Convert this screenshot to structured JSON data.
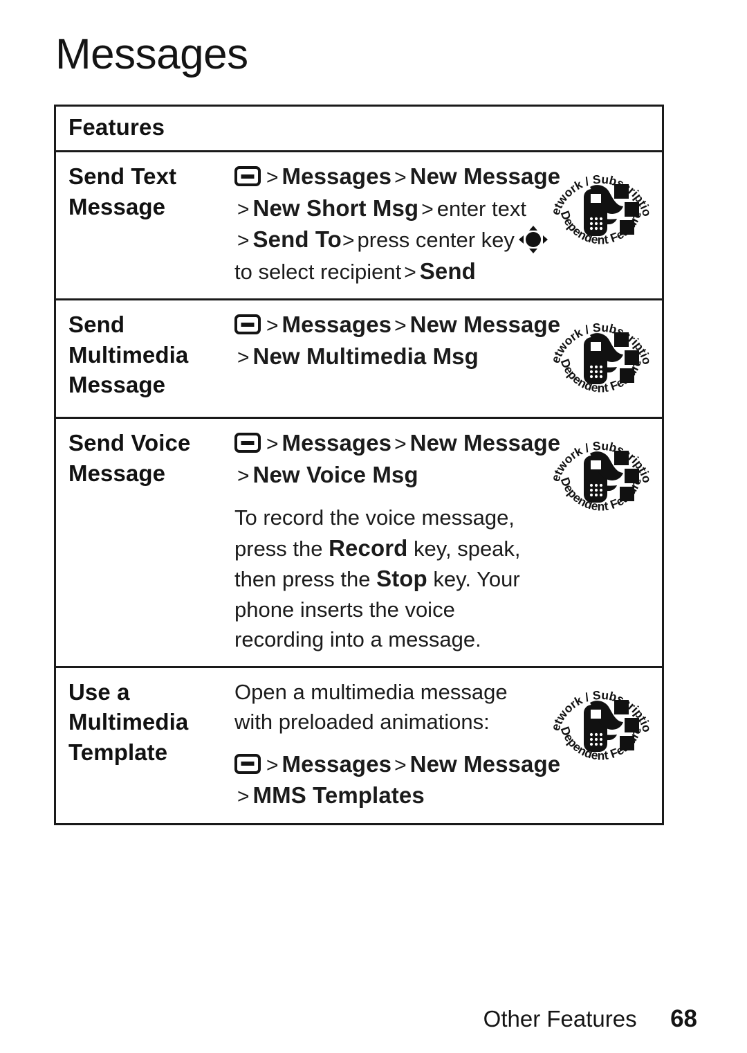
{
  "page": {
    "title": "Messages",
    "footer_section": "Other Features",
    "page_number": "68"
  },
  "icons": {
    "menu_key": "menu-key-icon",
    "center_key": "center-navigation-key-icon",
    "badge": "network-subscription-dependent-feature-icon"
  },
  "badge": {
    "top_text": "Network / Subscription",
    "bottom_text": "Dependent  Feature"
  },
  "table": {
    "header": "Features",
    "rows": [
      {
        "feature": [
          "Send Text",
          "Message"
        ],
        "steps": [
          {
            "menu_key": true,
            "parts": [
              {
                "t": "chev",
                "v": ">"
              },
              {
                "t": "menu",
                "v": "Messages"
              },
              {
                "t": "chev",
                "v": ">"
              },
              {
                "t": "menu",
                "v": "New Message"
              }
            ]
          },
          {
            "menu_key": false,
            "parts": [
              {
                "t": "chev",
                "v": ">"
              },
              {
                "t": "menu",
                "v": "New Short Msg"
              },
              {
                "t": "chev",
                "v": ">"
              },
              {
                "t": "plain",
                "v": "enter text"
              }
            ]
          },
          {
            "menu_key": false,
            "nav_key": true,
            "parts": [
              {
                "t": "chev",
                "v": ">"
              },
              {
                "t": "menu",
                "v": "Send To"
              },
              {
                "t": "chevtight",
                "v": ">"
              },
              {
                "t": "plain",
                "v": "press center key"
              }
            ]
          },
          {
            "menu_key": false,
            "parts": [
              {
                "t": "plain",
                "v": "to select recipient"
              },
              {
                "t": "chev",
                "v": ">"
              },
              {
                "t": "menu",
                "v": "Send"
              }
            ]
          }
        ],
        "badge": true
      },
      {
        "feature": [
          "Send",
          "Multimedia",
          "Message"
        ],
        "steps": [
          {
            "menu_key": true,
            "parts": [
              {
                "t": "chev",
                "v": ">"
              },
              {
                "t": "menu",
                "v": "Messages"
              },
              {
                "t": "chev",
                "v": ">"
              },
              {
                "t": "menu",
                "v": "New Message"
              }
            ]
          },
          {
            "menu_key": false,
            "parts": [
              {
                "t": "chev",
                "v": ">"
              },
              {
                "t": "menu",
                "v": "New Multimedia Msg"
              }
            ]
          }
        ],
        "badge": true
      },
      {
        "feature": [
          "Send Voice",
          "Message"
        ],
        "steps": [
          {
            "menu_key": true,
            "parts": [
              {
                "t": "chev",
                "v": ">"
              },
              {
                "t": "menu",
                "v": "Messages"
              },
              {
                "t": "chev",
                "v": ">"
              },
              {
                "t": "menu",
                "v": "New Message"
              }
            ]
          },
          {
            "menu_key": false,
            "parts": [
              {
                "t": "chev",
                "v": ">"
              },
              {
                "t": "menu",
                "v": "New Voice Msg"
              }
            ]
          }
        ],
        "paragraph": [
          {
            "t": "plain",
            "v": "To record the voice message, press the "
          },
          {
            "t": "menu",
            "v": "Record"
          },
          {
            "t": "plain",
            "v": " key, speak, then press the "
          },
          {
            "t": "menu",
            "v": "Stop"
          },
          {
            "t": "plain",
            "v": " key. Your phone inserts the voice recording into a message."
          }
        ],
        "badge": true
      },
      {
        "feature": [
          "Use a",
          "Multimedia",
          "Template"
        ],
        "intro": [
          {
            "t": "plain",
            "v": "Open a multimedia message with preloaded animations:"
          }
        ],
        "steps": [
          {
            "menu_key": true,
            "parts": [
              {
                "t": "chev",
                "v": ">"
              },
              {
                "t": "menu",
                "v": "Messages"
              },
              {
                "t": "chev",
                "v": ">"
              },
              {
                "t": "menu",
                "v": "New Message"
              }
            ]
          },
          {
            "menu_key": false,
            "parts": [
              {
                "t": "chev",
                "v": ">"
              },
              {
                "t": "menu",
                "v": "MMS Templates"
              }
            ]
          }
        ],
        "badge": true
      }
    ]
  }
}
